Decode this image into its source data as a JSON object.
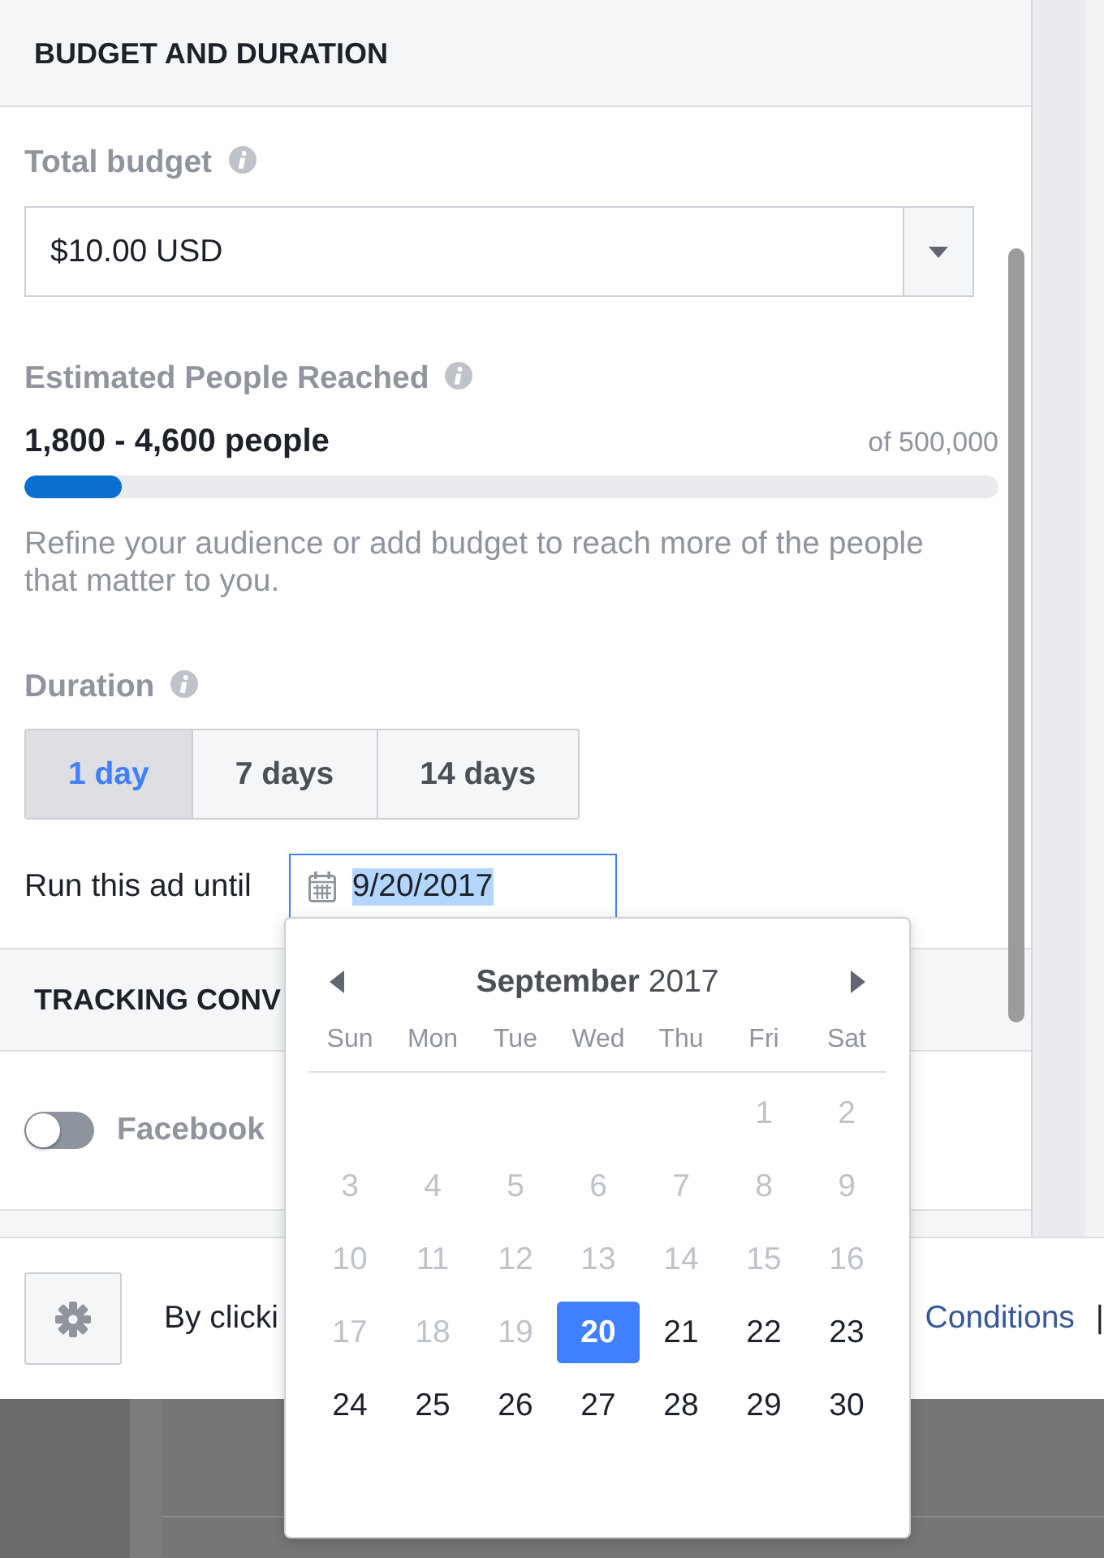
{
  "budget_section": {
    "title": "BUDGET AND DURATION",
    "total_budget": {
      "label": "Total budget",
      "value": "$10.00 USD"
    },
    "reach": {
      "label": "Estimated People Reached",
      "estimate": "1,800 - 4,600 people",
      "maximum": "of 500,000",
      "level": 0.1,
      "hint": "Refine your audience or add budget to reach more of the people that matter to you."
    },
    "duration": {
      "label": "Duration",
      "options": [
        {
          "label": "1 day",
          "selected": true
        },
        {
          "label": "7 days",
          "selected": false
        },
        {
          "label": "14 days",
          "selected": false
        }
      ]
    },
    "end_date": {
      "label": "Run this ad until",
      "value": "9/20/2017",
      "focused": true,
      "text_highlighted": true
    }
  },
  "tracking_section": {
    "title": "TRACKING CONV",
    "pixel_toggle": {
      "label": "Facebook",
      "on": false
    }
  },
  "footer": {
    "terms_text": "By clicki",
    "link": "Conditions",
    "separator": "|"
  },
  "date_picker": {
    "month_title": "**September** 2017",
    "weekdays": [
      "Sun",
      "Mon",
      "Tue",
      "Wed",
      "Thu",
      "Fri",
      "Sat"
    ],
    "weeks": [
      [
        {
          "day": "1",
          "disabled": true,
          "selected": false
        },
        {
          "day": "2",
          "disabled": true,
          "selected": false
        }
      ],
      [
        {
          "day": "3",
          "disabled": true,
          "selected": false
        },
        {
          "day": "4",
          "disabled": true,
          "selected": false
        },
        {
          "day": "5",
          "disabled": true,
          "selected": false
        },
        {
          "day": "6",
          "disabled": true,
          "selected": false
        },
        {
          "day": "7",
          "disabled": true,
          "selected": false
        },
        {
          "day": "8",
          "disabled": true,
          "selected": false
        },
        {
          "day": "9",
          "disabled": true,
          "selected": false
        }
      ],
      [
        {
          "day": "10",
          "disabled": true,
          "selected": false
        },
        {
          "day": "11",
          "disabled": true,
          "selected": false
        },
        {
          "day": "12",
          "disabled": true,
          "selected": false
        },
        {
          "day": "13",
          "disabled": true,
          "selected": false
        },
        {
          "day": "14",
          "disabled": true,
          "selected": false
        },
        {
          "day": "15",
          "disabled": true,
          "selected": false
        },
        {
          "day": "16",
          "disabled": true,
          "selected": false
        }
      ],
      [
        {
          "day": "17",
          "disabled": true,
          "selected": false
        },
        {
          "day": "18",
          "disabled": true,
          "selected": false
        },
        {
          "day": "19",
          "disabled": true,
          "selected": false
        },
        {
          "day": "20",
          "disabled": false,
          "selected": true
        },
        {
          "day": "21",
          "disabled": false,
          "selected": false
        },
        {
          "day": "22",
          "disabled": false,
          "selected": false
        },
        {
          "day": "23",
          "disabled": false,
          "selected": false
        }
      ],
      [
        {
          "day": "24",
          "disabled": false,
          "selected": false
        },
        {
          "day": "25",
          "disabled": false,
          "selected": false
        },
        {
          "day": "26",
          "disabled": false,
          "selected": false
        },
        {
          "day": "27",
          "disabled": false,
          "selected": false
        },
        {
          "day": "28",
          "disabled": false,
          "selected": false
        },
        {
          "day": "29",
          "disabled": false,
          "selected": false
        },
        {
          "day": "30",
          "disabled": false,
          "selected": false
        }
      ]
    ]
  }
}
